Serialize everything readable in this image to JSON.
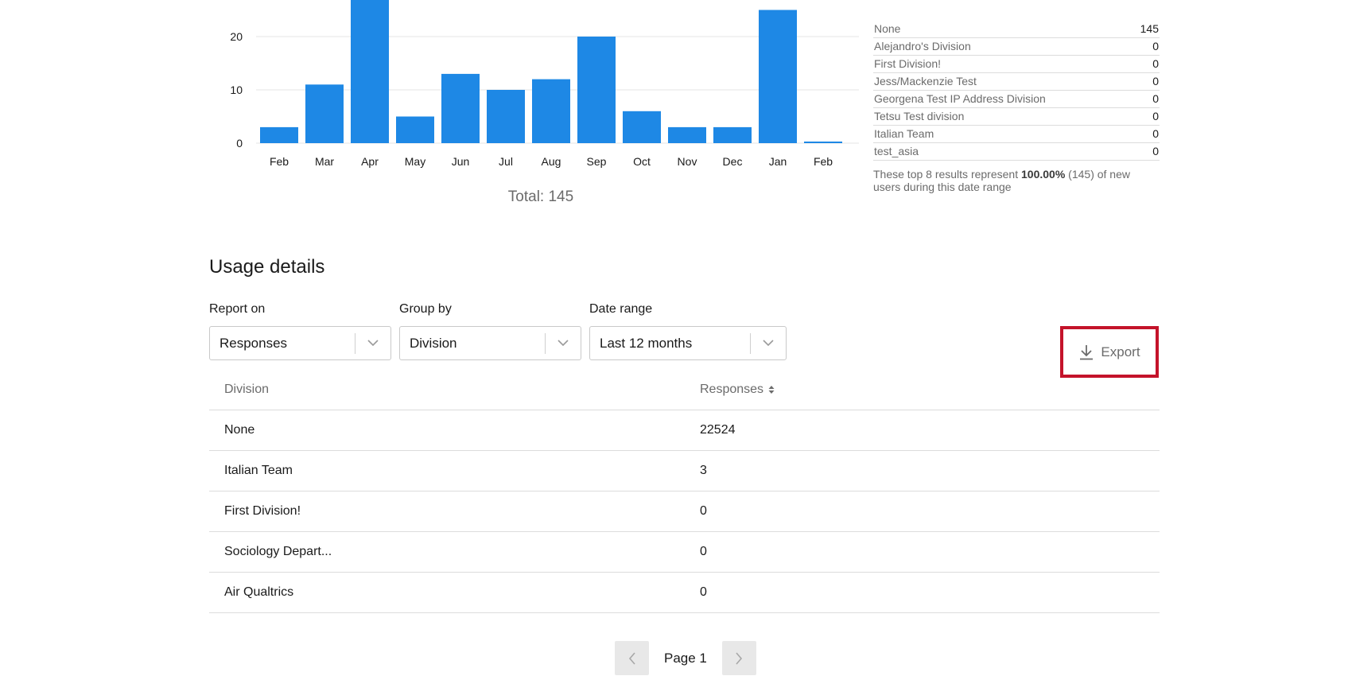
{
  "chart_data": {
    "type": "bar",
    "categories": [
      "Feb",
      "Mar",
      "Apr",
      "May",
      "Jun",
      "Jul",
      "Aug",
      "Sep",
      "Oct",
      "Nov",
      "Dec",
      "Jan",
      "Feb"
    ],
    "values": [
      3,
      11,
      28,
      5,
      13,
      10,
      12,
      20,
      6,
      3,
      3,
      25,
      0.3
    ],
    "yticks": [
      0,
      10,
      20
    ],
    "ylim": [
      0,
      27
    ],
    "grid": true,
    "color": "#1e88e5",
    "total_label": "Total: 145"
  },
  "summary": {
    "rows": [
      {
        "name": "None",
        "value": "145"
      },
      {
        "name": "Alejandro's Division",
        "value": "0"
      },
      {
        "name": "First Division!",
        "value": "0"
      },
      {
        "name": "Jess/Mackenzie Test",
        "value": "0"
      },
      {
        "name": "Georgena Test IP Address Division",
        "value": "0"
      },
      {
        "name": "Tetsu Test division",
        "value": "0"
      },
      {
        "name": "Italian Team",
        "value": "0"
      },
      {
        "name": "test_asia",
        "value": "0"
      }
    ],
    "note_pre": "These top 8 results represent ",
    "note_bold": "100.00%",
    "note_post": " (145) of new users during this date range"
  },
  "usage": {
    "title": "Usage details",
    "report_on": {
      "label": "Report on",
      "value": "Responses"
    },
    "group_by": {
      "label": "Group by",
      "value": "Division"
    },
    "date_range": {
      "label": "Date range",
      "value": "Last 12 months"
    },
    "export_label": "Export",
    "columns": [
      "Division",
      "Responses"
    ],
    "rows": [
      {
        "division": "None",
        "responses": "22524"
      },
      {
        "division": "Italian Team",
        "responses": "3"
      },
      {
        "division": "First Division!",
        "responses": "0"
      },
      {
        "division": "Sociology Depart...",
        "responses": "0"
      },
      {
        "division": "Air Qualtrics",
        "responses": "0"
      }
    ],
    "page_label": "Page 1"
  },
  "colors": {
    "accent": "#1e88e5",
    "highlight": "#c4132a"
  }
}
